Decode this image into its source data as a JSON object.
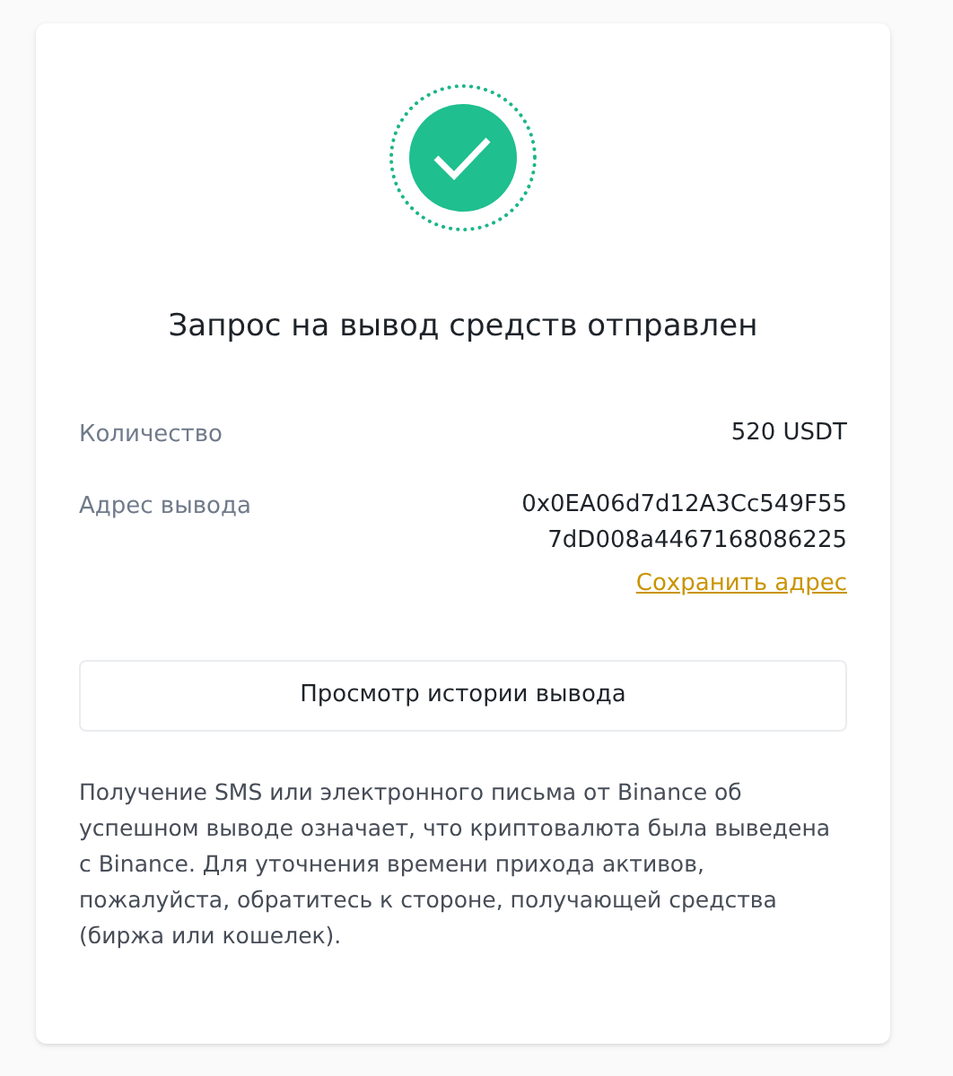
{
  "title": "Запрос на вывод средств отправлен",
  "details": [
    {
      "label": "Количество",
      "value_lines": [
        "520 USDT"
      ]
    },
    {
      "label": "Адрес вывода",
      "value_lines": [
        "0x0EA06d7d12A3Cc549F55",
        "7dD008a4467168086225"
      ],
      "link": "Сохранить адрес"
    }
  ],
  "history_button": "Просмотр истории вывода",
  "note": "Получение SMS или электронного письма от Binance об успешном выводе означает, что криптовалюта была выведена с Binance. Для уточнения времени прихода активов, пожалуйста, обратитесь к стороне, получающей средства (биржа или кошелек)."
}
